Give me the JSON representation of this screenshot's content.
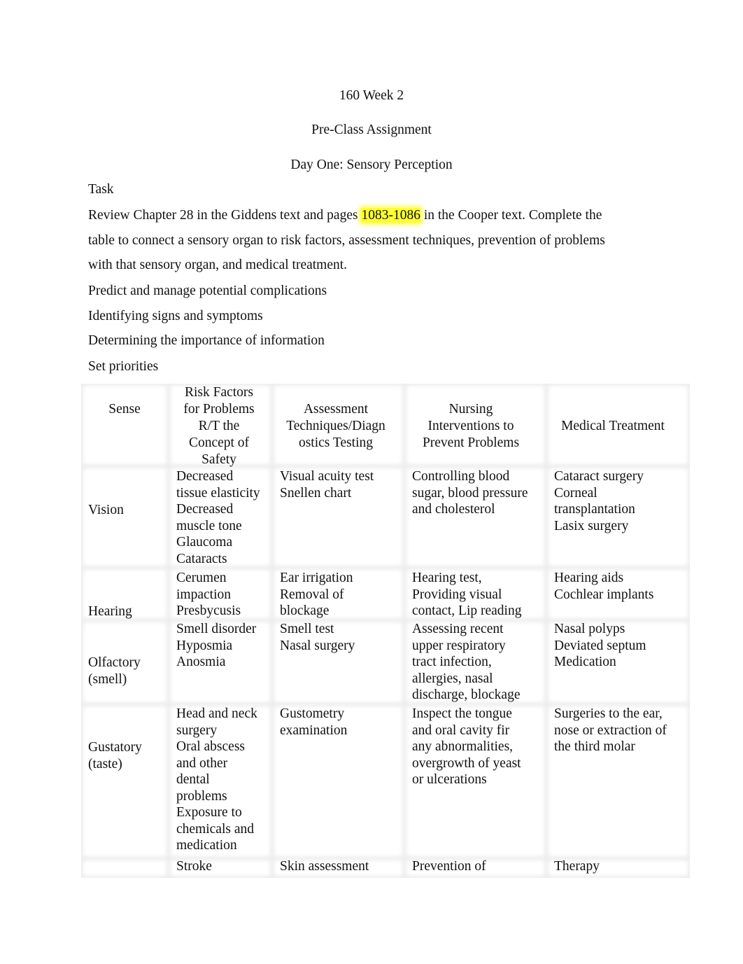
{
  "document": {
    "course_title": "160 Week 2",
    "assignment_title": "Pre-Class Assignment",
    "day_title": "Day One: Sensory Perception",
    "task_label": "Task",
    "instructions": {
      "line1_before": "Review Chapter 28 in the Giddens text and pages ",
      "line1_highlight": "1083-1086",
      "line1_after": " in the Cooper text. Complete the",
      "line2": "table to connect a sensory organ to risk factors, assessment techniques, prevention of problems",
      "line3": "with that sensory organ, and medical treatment."
    },
    "highlight_color": "#ffff33",
    "objectives": [
      "Predict and manage potential complications",
      "Identifying signs and symptoms",
      "Determining the importance of information",
      "Set priorities"
    ]
  },
  "table": {
    "headers": {
      "sense": "Sense",
      "risk_factors": [
        "Risk Factors",
        "for Problems",
        "R/T the",
        "Concept of",
        "Safety"
      ],
      "assessment": [
        "Assessment",
        "Techniques/Diagn",
        "ostics Testing"
      ],
      "nursing": [
        "Nursing",
        "Interventions to",
        "Prevent Problems"
      ],
      "medical": "Medical Treatment"
    },
    "rows": [
      {
        "sense": [
          "Vision"
        ],
        "risk_factors": [
          "Decreased",
          "tissue elasticity",
          "Decreased",
          "muscle tone",
          "Glaucoma",
          "Cataracts"
        ],
        "assessment": [
          "Visual acuity test",
          "Snellen chart"
        ],
        "nursing": [
          "Controlling blood",
          "sugar, blood pressure",
          "and cholesterol"
        ],
        "medical": [
          "Cataract surgery",
          "Corneal",
          "transplantation",
          "Lasix surgery"
        ]
      },
      {
        "sense": [
          "Hearing"
        ],
        "risk_factors": [
          "Cerumen",
          "impaction",
          "Presbycusis"
        ],
        "assessment": [
          "Ear irrigation",
          "Removal of",
          "blockage"
        ],
        "nursing": [
          "Hearing test,",
          "Providing visual",
          "contact, Lip reading"
        ],
        "medical": [
          "Hearing aids",
          "Cochlear implants"
        ]
      },
      {
        "sense": [
          "Olfactory",
          "(smell)"
        ],
        "risk_factors": [
          "Smell disorder",
          "Hyposmia",
          "Anosmia"
        ],
        "assessment": [
          "Smell test",
          "Nasal surgery"
        ],
        "nursing": [
          "Assessing recent",
          "upper respiratory",
          "tract infection,",
          "allergies, nasal",
          "discharge, blockage"
        ],
        "medical": [
          "Nasal polyps",
          "Deviated septum",
          "Medication"
        ]
      },
      {
        "sense": [
          "Gustatory",
          "(taste)"
        ],
        "risk_factors": [
          "Head and neck",
          "surgery",
          "Oral abscess",
          "and other",
          "dental",
          "problems",
          "Exposure to",
          "chemicals and",
          "medication"
        ],
        "assessment": [
          "Gustometry",
          "examination"
        ],
        "nursing": [
          "Inspect the tongue",
          "and oral cavity fir",
          "any abnormalities,",
          "overgrowth of yeast",
          "or ulcerations"
        ],
        "medical": [
          "Surgeries to the ear,",
          "nose or extraction of",
          "the third molar"
        ]
      },
      {
        "sense": [
          ""
        ],
        "risk_factors": [
          "Stroke"
        ],
        "assessment": [
          "Skin assessment"
        ],
        "nursing": [
          "Prevention of"
        ],
        "medical": [
          "Therapy"
        ]
      }
    ]
  }
}
